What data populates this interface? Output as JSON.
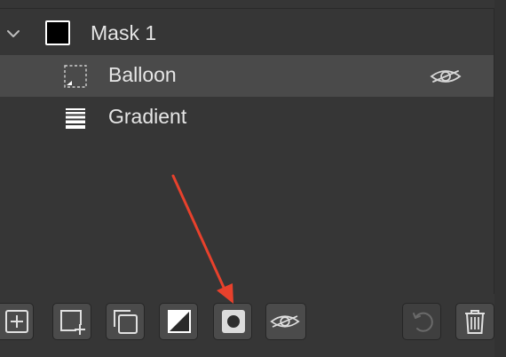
{
  "layers": [
    {
      "label": "Mask 1",
      "icon": "mask-thumbnail-icon",
      "expanded": true
    },
    {
      "label": "Balloon",
      "icon": "selection-shape-icon",
      "selected": true,
      "visibility_icon": "eye-hidden-icon"
    },
    {
      "label": "Gradient",
      "icon": "gradient-icon"
    }
  ],
  "toolbar": [
    {
      "icon": "add-icon"
    },
    {
      "icon": "add-child-icon"
    },
    {
      "icon": "duplicate-icon"
    },
    {
      "icon": "mask-icon"
    },
    {
      "icon": "fill-circle-icon"
    },
    {
      "icon": "eye-hidden-icon"
    },
    {
      "icon": "undo-icon",
      "enabled": false
    },
    {
      "icon": "trash-icon"
    }
  ],
  "colors": {
    "background": "#363636",
    "selected_row": "#4a4a4a",
    "text": "#e6e6e6",
    "button": "#4b4b4b",
    "annotation": "#e8412c"
  }
}
